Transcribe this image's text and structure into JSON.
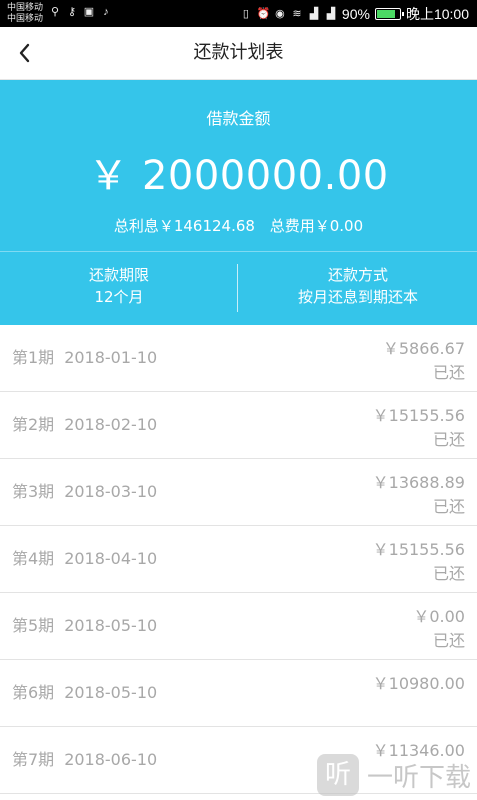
{
  "status_bar": {
    "carrier_1": "中国移动",
    "carrier_2": "中国移动",
    "battery": "90%",
    "time": "晚上10:00",
    "battery_color": "#4cd964"
  },
  "nav": {
    "title": "还款计划表",
    "back_icon": "chevron-left-icon"
  },
  "summary": {
    "loan_label": "借款金额",
    "amount": "￥ 2000000.00",
    "interest": "总利息￥146124.68",
    "fee": "总费用￥0.00",
    "term_label": "还款期限",
    "term_value": "12个月",
    "method_label": "还款方式",
    "method_value": "按月还息到期还本",
    "bg_color": "#35c5ea"
  },
  "schedule": [
    {
      "period": "第1期",
      "date": "2018-01-10",
      "amount": "￥5866.67",
      "status": "已还"
    },
    {
      "period": "第2期",
      "date": "2018-02-10",
      "amount": "￥15155.56",
      "status": "已还"
    },
    {
      "period": "第3期",
      "date": "2018-03-10",
      "amount": "￥13688.89",
      "status": "已还"
    },
    {
      "period": "第4期",
      "date": "2018-04-10",
      "amount": "￥15155.56",
      "status": "已还"
    },
    {
      "period": "第5期",
      "date": "2018-05-10",
      "amount": "￥0.00",
      "status": "已还"
    },
    {
      "period": "第6期",
      "date": "2018-05-10",
      "amount": "￥10980.00",
      "status": ""
    },
    {
      "period": "第7期",
      "date": "2018-06-10",
      "amount": "￥11346.00",
      "status": ""
    }
  ],
  "watermark": {
    "logo_char": "听",
    "text": "一听下载"
  }
}
